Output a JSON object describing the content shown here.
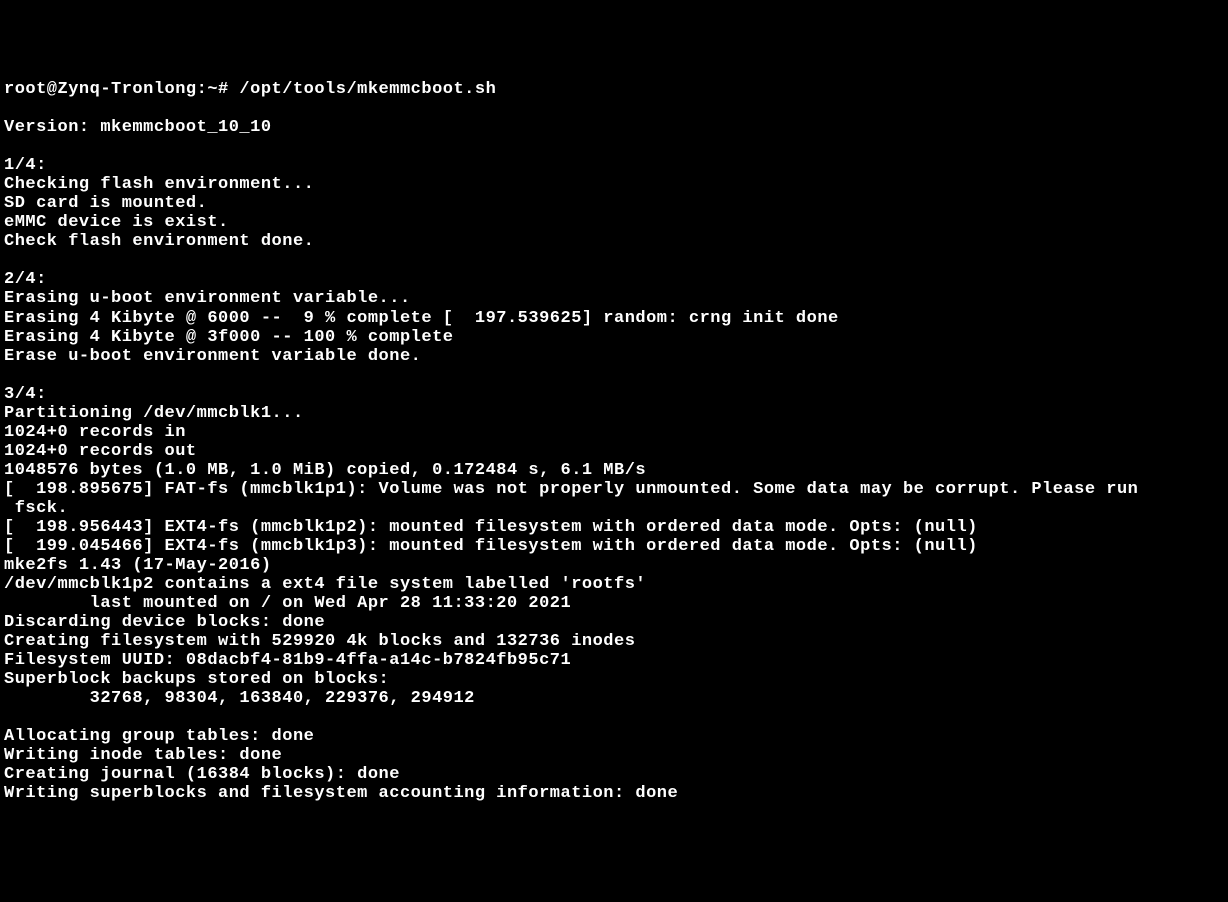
{
  "terminal": {
    "lines": [
      "root@Zynq-Tronlong:~# /opt/tools/mkemmcboot.sh",
      "",
      "Version: mkemmcboot_10_10",
      "",
      "1/4:",
      "Checking flash environment...",
      "SD card is mounted.",
      "eMMC device is exist.",
      "Check flash environment done.",
      "",
      "2/4:",
      "Erasing u-boot environment variable...",
      "Erasing 4 Kibyte @ 6000 --  9 % complete [  197.539625] random: crng init done",
      "Erasing 4 Kibyte @ 3f000 -- 100 % complete",
      "Erase u-boot environment variable done.",
      "",
      "3/4:",
      "Partitioning /dev/mmcblk1...",
      "1024+0 records in",
      "1024+0 records out",
      "1048576 bytes (1.0 MB, 1.0 MiB) copied, 0.172484 s, 6.1 MB/s",
      "[  198.895675] FAT-fs (mmcblk1p1): Volume was not properly unmounted. Some data may be corrupt. Please run",
      " fsck.",
      "[  198.956443] EXT4-fs (mmcblk1p2): mounted filesystem with ordered data mode. Opts: (null)",
      "[  199.045466] EXT4-fs (mmcblk1p3): mounted filesystem with ordered data mode. Opts: (null)",
      "mke2fs 1.43 (17-May-2016)",
      "/dev/mmcblk1p2 contains a ext4 file system labelled 'rootfs'",
      "        last mounted on / on Wed Apr 28 11:33:20 2021",
      "Discarding device blocks: done",
      "Creating filesystem with 529920 4k blocks and 132736 inodes",
      "Filesystem UUID: 08dacbf4-81b9-4ffa-a14c-b7824fb95c71",
      "Superblock backups stored on blocks:",
      "        32768, 98304, 163840, 229376, 294912",
      "",
      "Allocating group tables: done",
      "Writing inode tables: done",
      "Creating journal (16384 blocks): done",
      "Writing superblocks and filesystem accounting information: done"
    ]
  }
}
